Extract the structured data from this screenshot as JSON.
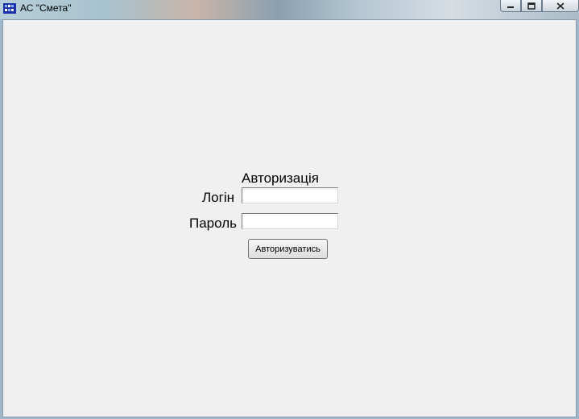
{
  "window": {
    "title": "АС \"Смета\"",
    "icons": {
      "app": "app-icon",
      "minimize": "minimize-icon",
      "maximize": "maximize-icon",
      "close": "close-icon"
    }
  },
  "auth": {
    "heading": "Авторизація",
    "login_label": "Логін",
    "login_value": "",
    "password_label": "Пароль",
    "password_value": "",
    "submit_label": "Авторизуватись"
  }
}
